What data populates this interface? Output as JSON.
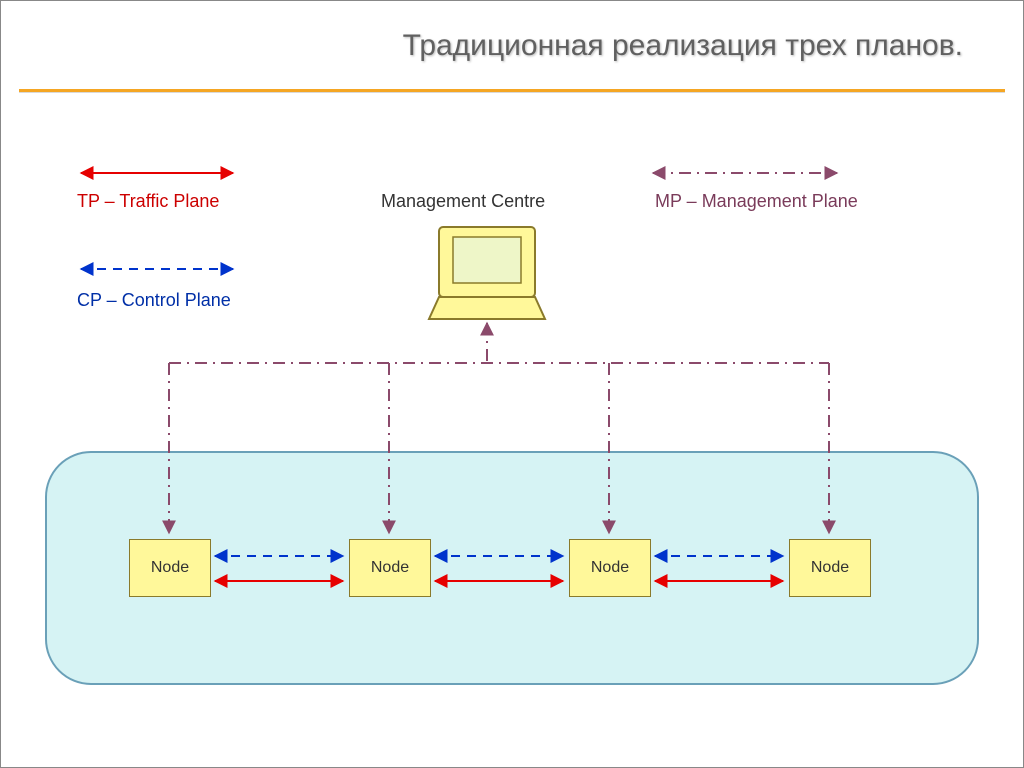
{
  "title": "Традиционная реализация трех планов.",
  "legend": {
    "tp": "TP – Traffic Plane",
    "cp": "CP – Control Plane",
    "mp": "MP – Management Plane"
  },
  "mgmt_centre": "Management Centre",
  "nodes": [
    "Node",
    "Node",
    "Node",
    "Node"
  ],
  "colors": {
    "tp": "#e60000",
    "cp": "#0033cc",
    "mp": "#8b4a6b",
    "node_fill": "#fff89a",
    "panel_fill": "#d6f3f4",
    "accent": "#f5a623"
  }
}
